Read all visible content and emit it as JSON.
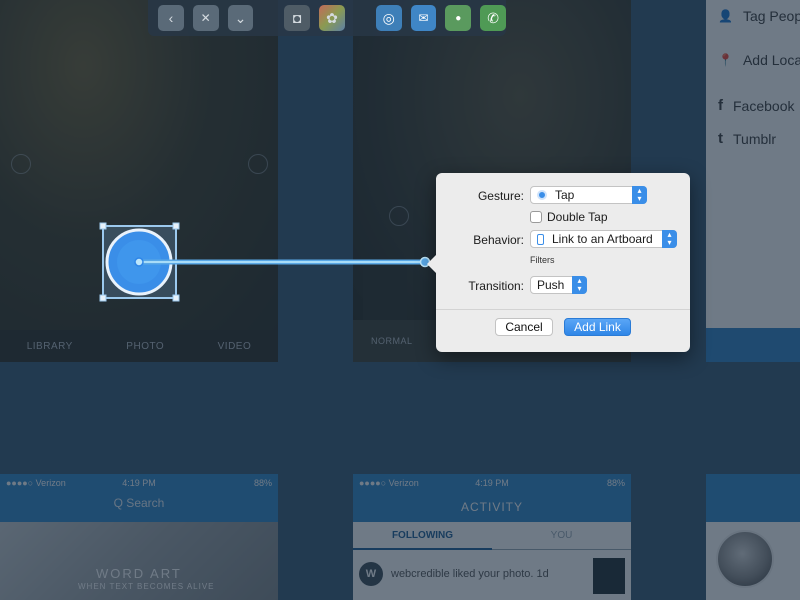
{
  "toolbar": {
    "items": [
      {
        "name": "back",
        "glyph": "‹"
      },
      {
        "name": "close",
        "glyph": "✕"
      },
      {
        "name": "dropdown",
        "glyph": "⌄"
      },
      {
        "name": "camera",
        "glyph": "◘"
      },
      {
        "name": "photos",
        "glyph": "✿"
      },
      {
        "name": "safari",
        "glyph": "◎"
      },
      {
        "name": "mail",
        "glyph": "✉"
      },
      {
        "name": "messages",
        "glyph": "●"
      },
      {
        "name": "phone",
        "glyph": "✆"
      }
    ]
  },
  "camera_artboard": {
    "tabs": [
      "LIBRARY",
      "PHOTO",
      "VIDEO"
    ]
  },
  "filters_artboard": {
    "label": "NORMAL"
  },
  "profile_artboard": {
    "rows": [
      {
        "icon": "person-tag-icon",
        "glyph": "👤",
        "label": "Tag People"
      },
      {
        "icon": "location-pin-icon",
        "glyph": "📍",
        "label": "Add Location"
      },
      {
        "icon": "facebook-icon",
        "glyph": "f",
        "label": "Facebook"
      },
      {
        "icon": "tumblr-icon",
        "glyph": "t",
        "label": "Tumblr"
      }
    ]
  },
  "search_artboard": {
    "carrier": "●●●●○ Verizon",
    "time": "4:19 PM",
    "battery": "88%",
    "search_placeholder": "Q Search",
    "hero_title": "WORD ART",
    "hero_subtitle": "WHEN TEXT BECOMES ALIVE"
  },
  "activity_artboard": {
    "carrier": "●●●●○ Verizon",
    "time": "4:19 PM",
    "battery": "88%",
    "title": "ACTIVITY",
    "segments": [
      "FOLLOWING",
      "YOU"
    ],
    "row_avatar": "W",
    "row_text": "webcredible liked your photo. 1d"
  },
  "popover": {
    "gesture_label": "Gesture:",
    "gesture_value": "Tap",
    "double_tap_label": "Double Tap",
    "behavior_label": "Behavior:",
    "behavior_value": "Link to an Artboard",
    "filters_note": "Filters",
    "transition_label": "Transition:",
    "transition_value": "Push",
    "cancel_label": "Cancel",
    "confirm_label": "Add Link"
  },
  "colors": {
    "accent": "#3a8ee8",
    "link_line": "#7cc4f0",
    "canvas": "#223a50"
  }
}
